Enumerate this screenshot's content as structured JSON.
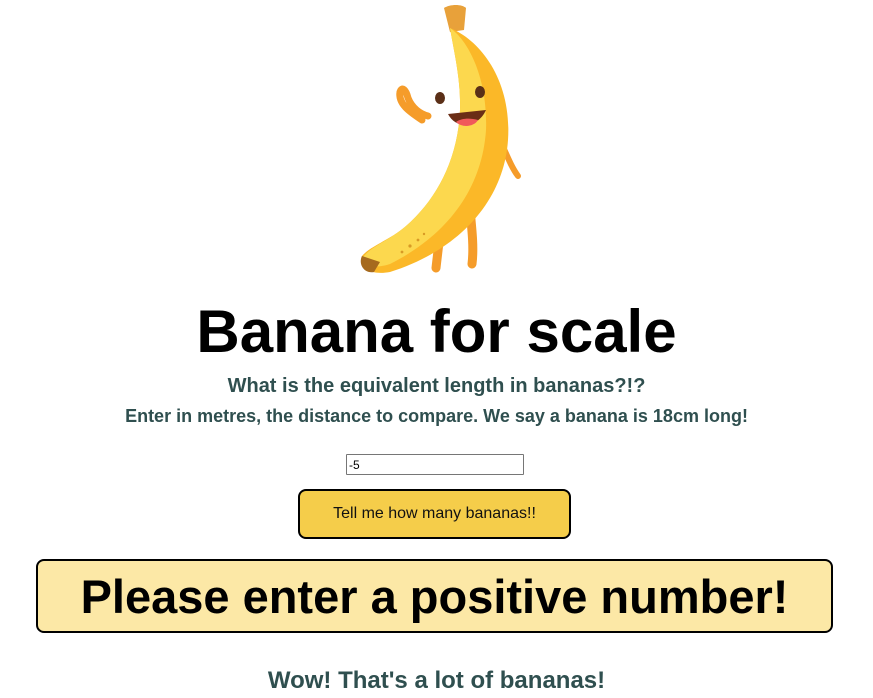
{
  "header": {
    "mascot_icon": "banana-mascot-icon",
    "title": "Banana for scale",
    "subtitle": "What is the equivalent length in bananas?!?",
    "instructions": "Enter in metres, the distance to compare. We say a banana is 18cm long!"
  },
  "form": {
    "distance_value": "-5",
    "submit_label": "Tell me how many bananas!!"
  },
  "result": {
    "message": "Please enter a positive number!"
  },
  "footer": {
    "message": "Wow! That's a lot of bananas!"
  },
  "colors": {
    "button_background": "#f5cd4a",
    "result_background": "#fce8a6",
    "subtitle_text": "#2f4f4f",
    "banana_yellow": "#fcd84e",
    "banana_orange": "#f59c2a"
  }
}
